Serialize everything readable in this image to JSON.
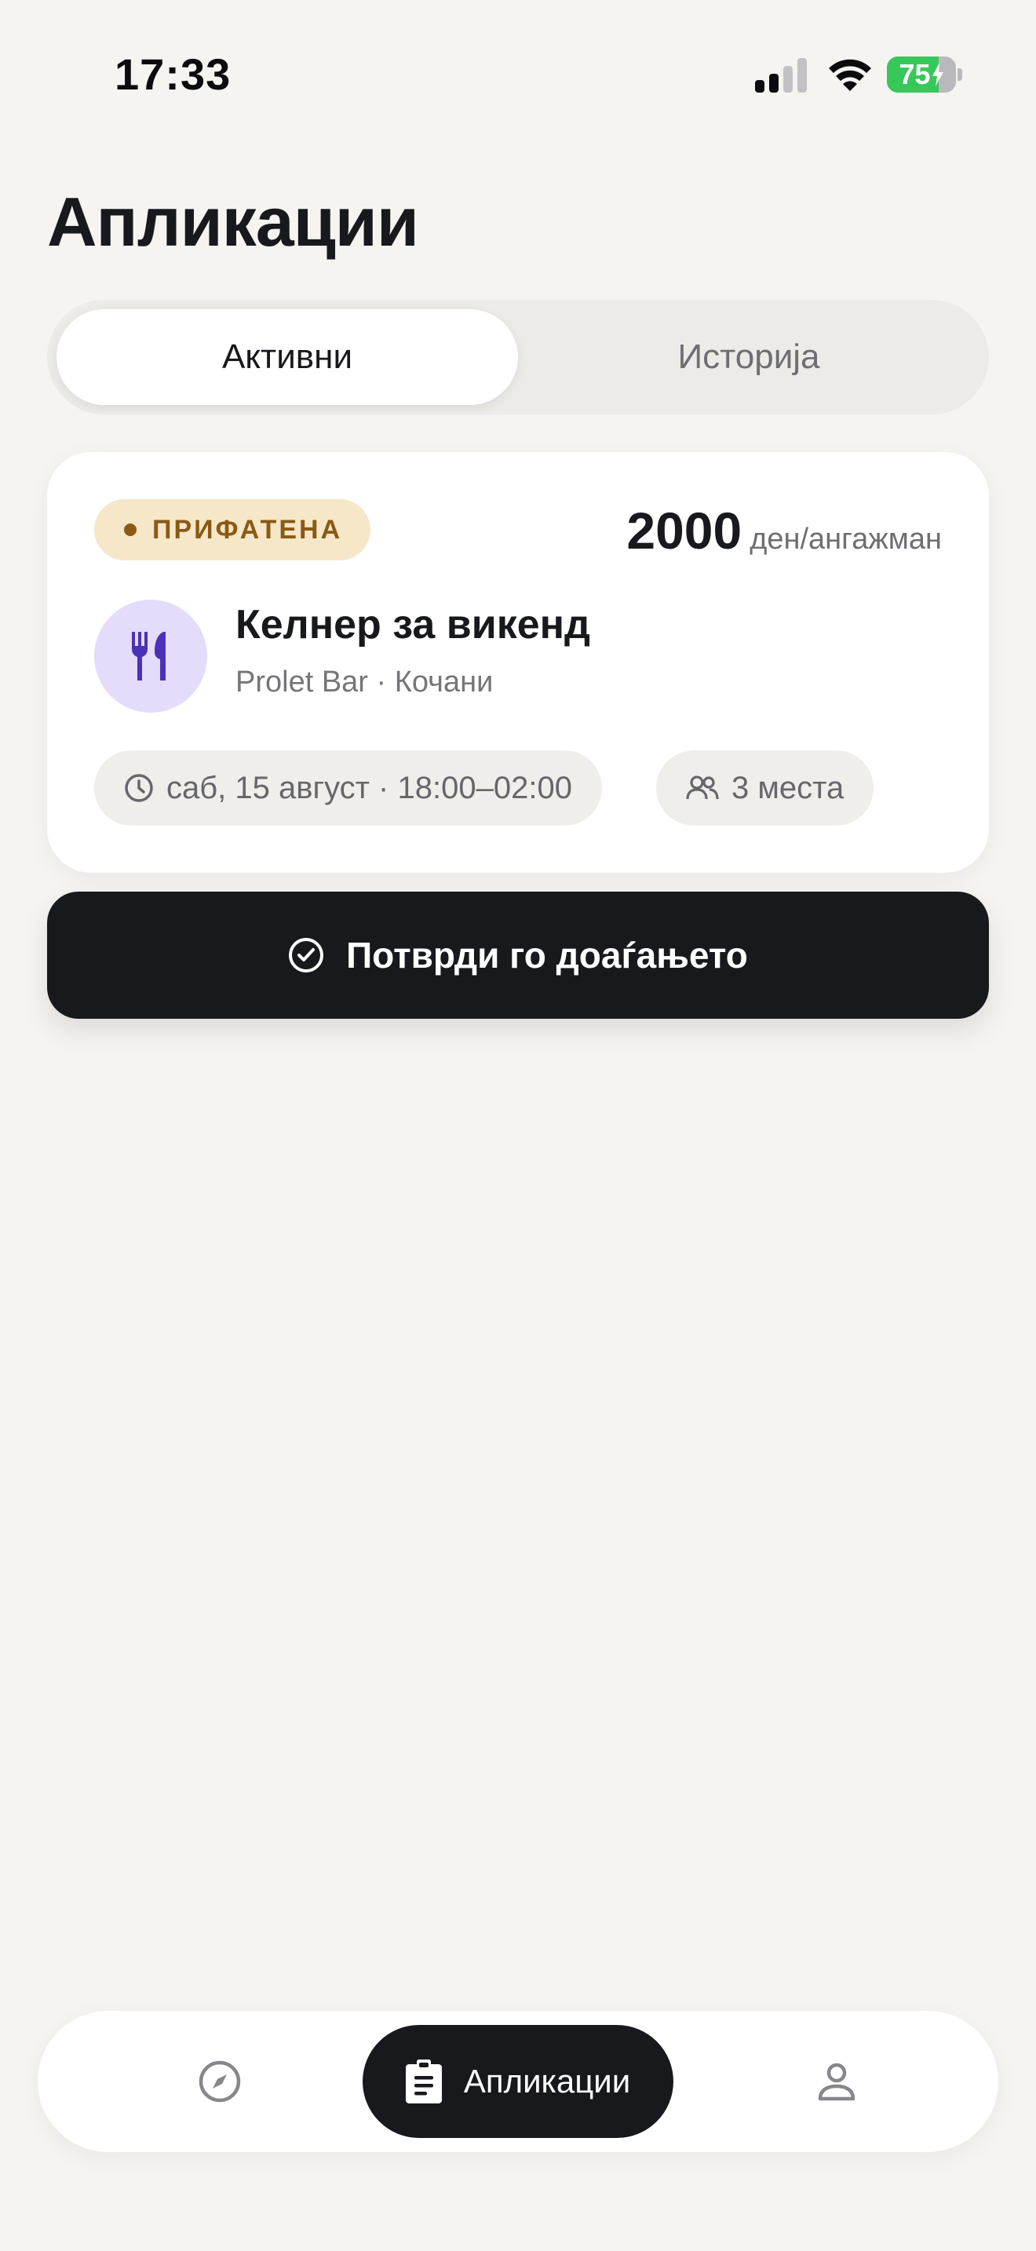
{
  "status_bar": {
    "time": "17:33",
    "battery_level": "75",
    "battery_fraction": 0.75,
    "icons": [
      "cellular-signal-icon",
      "wifi-icon",
      "battery-charging-icon"
    ]
  },
  "page": {
    "title": "Апликации"
  },
  "tabs": [
    {
      "label": "Активни",
      "active": true
    },
    {
      "label": "Историја",
      "active": false
    }
  ],
  "application_card": {
    "status": "ПРИФАТЕНА",
    "status_color": "#8a5a14",
    "status_bg": "#f6e7c8",
    "price_amount": "2000",
    "price_unit": "ден/ангажман",
    "job_icon": "fork-knife-icon",
    "job_icon_color": "#4a32b8",
    "job_icon_bg": "#e5dbfb",
    "job_title": "Келнер за викенд",
    "job_subtitle": "Prolet Bar · Кочани",
    "schedule": "саб, 15 август · 18:00–02:00",
    "places": "3 места"
  },
  "confirm_button": {
    "label": "Потврди го доаѓањето",
    "icon": "check-circle-icon"
  },
  "bottom_nav": {
    "items": [
      {
        "icon": "compass-icon",
        "label": "",
        "active": false
      },
      {
        "icon": "clipboard-icon",
        "label": "Апликации",
        "active": true
      },
      {
        "icon": "user-icon",
        "label": "",
        "active": false
      }
    ]
  },
  "colors": {
    "background": "#f5f4f1",
    "primary_dark": "#18191d",
    "battery_green": "#38c759"
  }
}
